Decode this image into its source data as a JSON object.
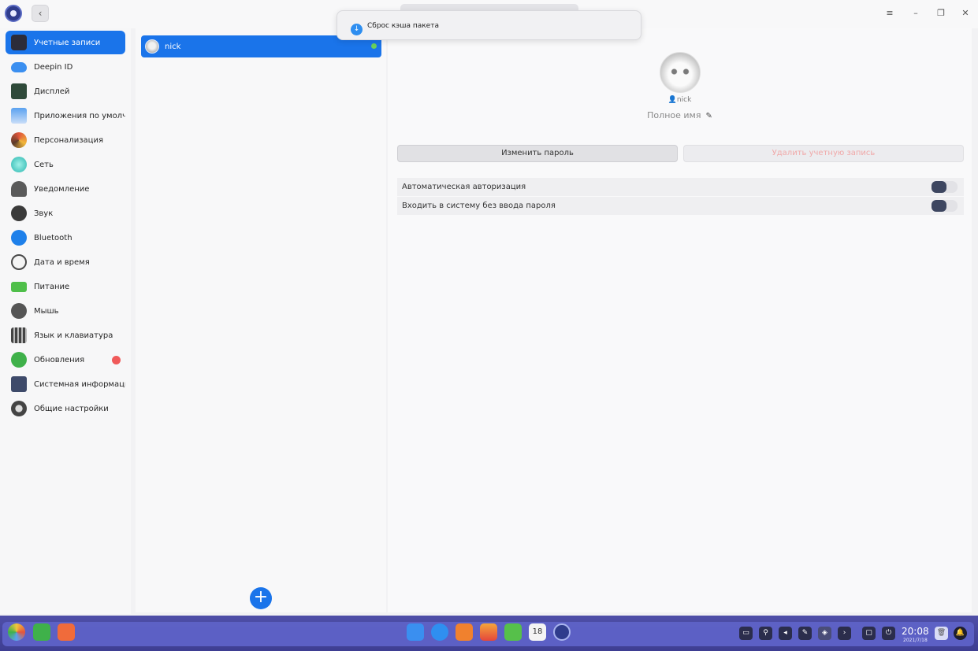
{
  "sidebar": {
    "items": [
      {
        "label": "Учетные записи",
        "icon": "user-accounts-icon",
        "active": true
      },
      {
        "label": "Deepin ID",
        "icon": "cloud-icon"
      },
      {
        "label": "Дисплей",
        "icon": "monitor-icon"
      },
      {
        "label": "Приложения по умолча...",
        "icon": "default-apps-icon"
      },
      {
        "label": "Персонализация",
        "icon": "palette-icon"
      },
      {
        "label": "Сеть",
        "icon": "network-icon"
      },
      {
        "label": "Уведомление",
        "icon": "bell-icon"
      },
      {
        "label": "Звук",
        "icon": "speaker-icon"
      },
      {
        "label": "Bluetooth",
        "icon": "bluetooth-icon"
      },
      {
        "label": "Дата и время",
        "icon": "clock-icon"
      },
      {
        "label": "Питание",
        "icon": "battery-icon"
      },
      {
        "label": "Мышь",
        "icon": "mouse-icon"
      },
      {
        "label": "Язык и клавиатура",
        "icon": "keyboard-icon"
      },
      {
        "label": "Обновления",
        "icon": "update-icon",
        "badge": true
      },
      {
        "label": "Системная информация",
        "icon": "system-info-icon"
      },
      {
        "label": "Общие настройки",
        "icon": "general-settings-icon"
      }
    ]
  },
  "users": {
    "list": [
      {
        "name": "nick",
        "online": true
      }
    ],
    "add_label": "+"
  },
  "detail": {
    "username": "nick",
    "fullname_placeholder": "Полное имя",
    "change_password": "Изменить пароль",
    "delete_account": "Удалить учетную запись",
    "settings": [
      {
        "label": "Автоматическая авторизация",
        "enabled": false
      },
      {
        "label": "Входить в систему без ввода пароля",
        "enabled": false
      }
    ]
  },
  "toast": {
    "text": "Сброс кэша пакета"
  },
  "dock": {
    "time": "20:08",
    "date": "2021/7/18",
    "calendar_day": "18"
  },
  "colors": {
    "accent": "#1a74ea",
    "badge": "#f05a5a",
    "online": "#6ad05c",
    "dock": "#5e62c7"
  }
}
